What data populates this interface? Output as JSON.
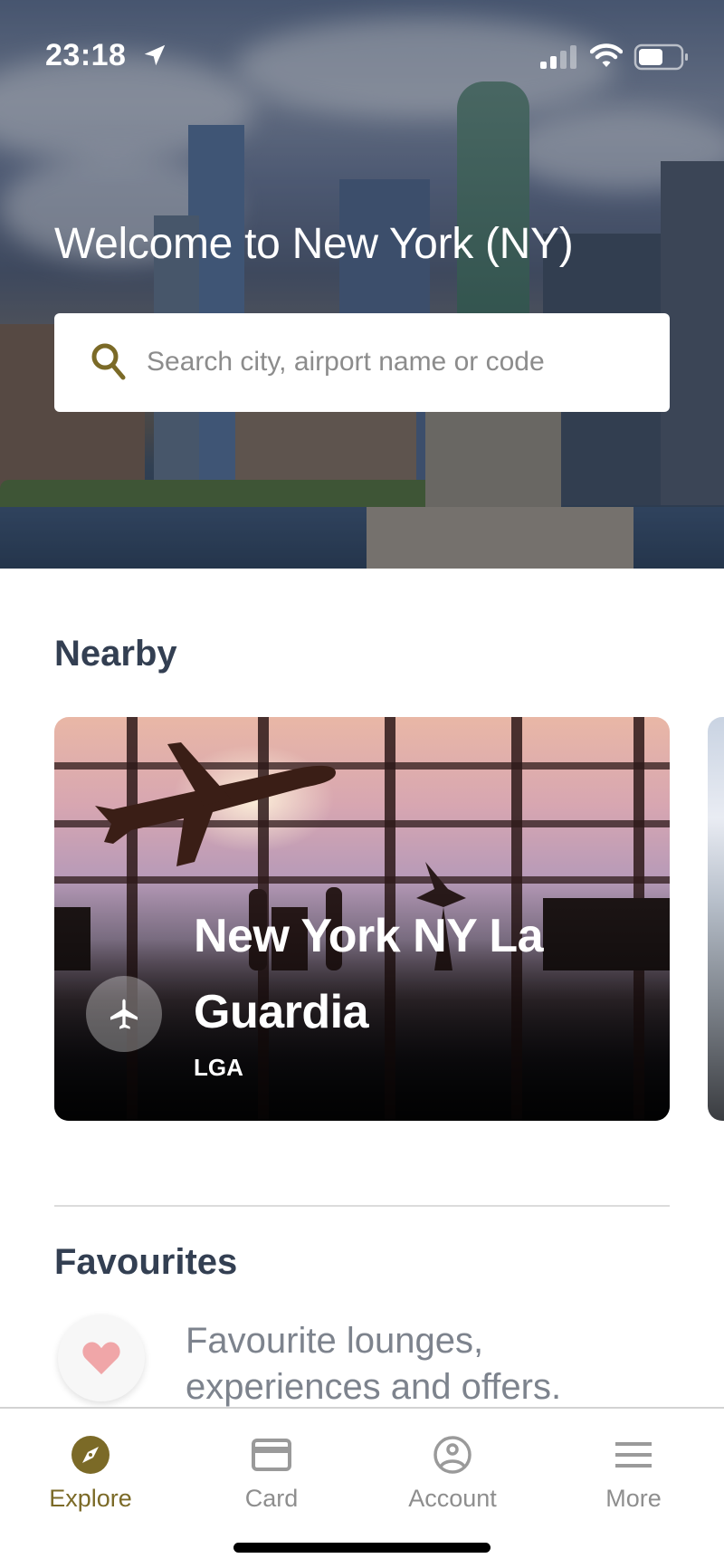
{
  "status_bar": {
    "time": "23:18",
    "icons": [
      "location-arrow-icon",
      "cellular-signal-icon",
      "wifi-icon",
      "battery-icon"
    ]
  },
  "hero": {
    "title": "Welcome to New York (NY)",
    "background": "new-york-skyline-statue-of-liberty"
  },
  "search": {
    "placeholder": "Search city, airport name or code",
    "value": "",
    "icon": "search-icon"
  },
  "nearby": {
    "title": "Nearby",
    "cards": [
      {
        "title": "New York NY La Guardia",
        "code": "LGA",
        "icon": "airplane-icon",
        "image": "airport-terminal-plane-silhouette"
      }
    ]
  },
  "favourites": {
    "title": "Favourites",
    "empty_text": "Favourite lounges, experiences and offers.",
    "icon": "heart-icon"
  },
  "tab_bar": {
    "tabs": [
      {
        "label": "Explore",
        "icon": "compass-icon",
        "active": true
      },
      {
        "label": "Card",
        "icon": "credit-card-icon",
        "active": false
      },
      {
        "label": "Account",
        "icon": "account-circle-icon",
        "active": false
      },
      {
        "label": "More",
        "icon": "menu-icon",
        "active": false
      }
    ]
  },
  "colors": {
    "accent": "#7b6a27",
    "heading": "#333f52",
    "muted_text": "#7d838d",
    "tab_inactive": "#8e8e8e",
    "heart": "#f0a6a8"
  }
}
